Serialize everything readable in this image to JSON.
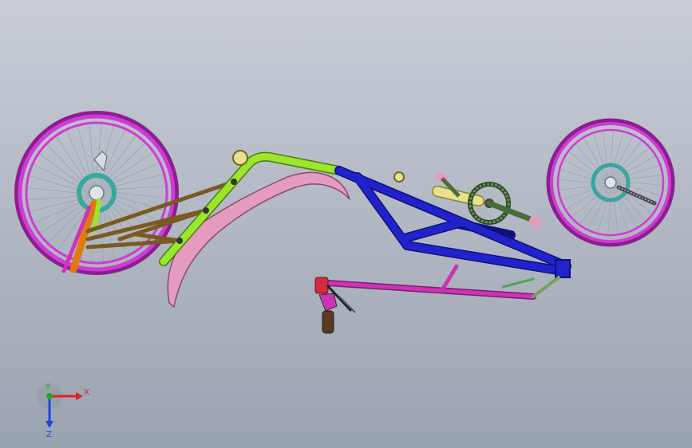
{
  "viewport": {
    "background_top": "#c9ced6",
    "background_bottom": "#9aa3b0"
  },
  "model": {
    "colors": {
      "wheel_rim": "#d13ad6",
      "wheel_rim_dark": "#8a1f8e",
      "tire": "#1b1b1b",
      "spoke": "#9aa3a8",
      "disc": "#3aa6a0",
      "main_frame": "#2222cc",
      "top_tube": "#9be52b",
      "seat_rail": "#e59bbd",
      "swing_arm": "#7a5a1e",
      "crank_tube": "#e8e08a",
      "chainring": "#4a6b3a",
      "boom": "#cc33b5",
      "fork": "#e07a10",
      "steering": "#d42b3e"
    }
  },
  "triad": {
    "x_label": "X",
    "y_label": "Y",
    "z_label": "Z",
    "x_color": "#e02020",
    "y_color": "#22aa22",
    "z_color": "#2244dd"
  }
}
